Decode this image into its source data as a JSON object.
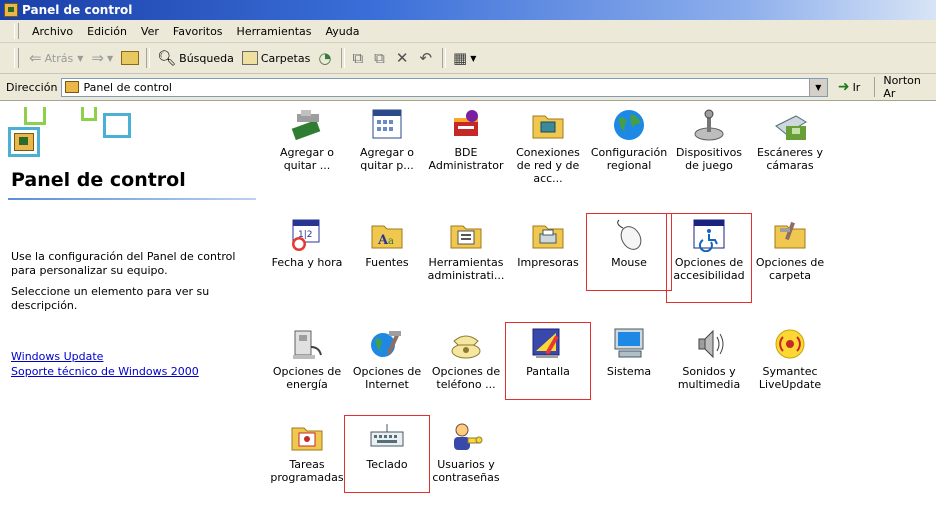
{
  "window": {
    "title": "Panel de control"
  },
  "menu": [
    "Archivo",
    "Edición",
    "Ver",
    "Favoritos",
    "Herramientas",
    "Ayuda"
  ],
  "toolbar": {
    "back": "Atrás",
    "search": "Búsqueda",
    "folders": "Carpetas"
  },
  "address": {
    "label": "Dirección",
    "value": "Panel de control",
    "go": "Ir",
    "norton": "Norton Ar"
  },
  "sidebar": {
    "title": "Panel de control",
    "description": "Use la configuración del Panel de control para personalizar su equipo.",
    "hint": "Seleccione un elemento para ver su descripción.",
    "links": [
      "Windows Update",
      "Soporte técnico de Windows 2000"
    ]
  },
  "items": [
    {
      "label": "Agregar o quitar ...",
      "icon": "add-remove-hardware-icon"
    },
    {
      "label": "Agregar o quitar p...",
      "icon": "add-remove-programs-icon"
    },
    {
      "label": "BDE Administrator",
      "icon": "bde-administrator-icon"
    },
    {
      "label": "Conexiones de red y de acc...",
      "icon": "network-connections-icon"
    },
    {
      "label": "Configuración regional",
      "icon": "globe-icon"
    },
    {
      "label": "Dispositivos de juego",
      "icon": "joystick-icon"
    },
    {
      "label": "Escáneres y cámaras",
      "icon": "scanner-icon"
    },
    {
      "label": "Fecha y hora",
      "icon": "calendar-clock-icon"
    },
    {
      "label": "Fuentes",
      "icon": "fonts-folder-icon"
    },
    {
      "label": "Herramientas administrati...",
      "icon": "admin-tools-icon"
    },
    {
      "label": "Impresoras",
      "icon": "printer-folder-icon"
    },
    {
      "label": "Mouse",
      "icon": "mouse-icon",
      "highlighted": true
    },
    {
      "label": "Opciones de accesibilidad",
      "icon": "accessibility-icon",
      "highlighted": true
    },
    {
      "label": "Opciones de carpeta",
      "icon": "folder-options-icon"
    },
    {
      "label": "Opciones de energía",
      "icon": "power-icon"
    },
    {
      "label": "Opciones de Internet",
      "icon": "internet-globe-icon"
    },
    {
      "label": "Opciones de teléfono ...",
      "icon": "phone-icon"
    },
    {
      "label": "Pantalla",
      "icon": "display-icon",
      "highlighted": true
    },
    {
      "label": "Sistema",
      "icon": "computer-icon"
    },
    {
      "label": "Sonidos y multimedia",
      "icon": "speaker-icon"
    },
    {
      "label": "Symantec LiveUpdate",
      "icon": "liveupdate-icon"
    },
    {
      "label": "Tareas programadas",
      "icon": "scheduled-tasks-icon"
    },
    {
      "label": "Teclado",
      "icon": "keyboard-icon",
      "highlighted": true
    },
    {
      "label": "Usuarios y contraseñas",
      "icon": "users-icon"
    }
  ],
  "colors": {
    "highlight": "#e23030",
    "link": "#0000cc"
  }
}
